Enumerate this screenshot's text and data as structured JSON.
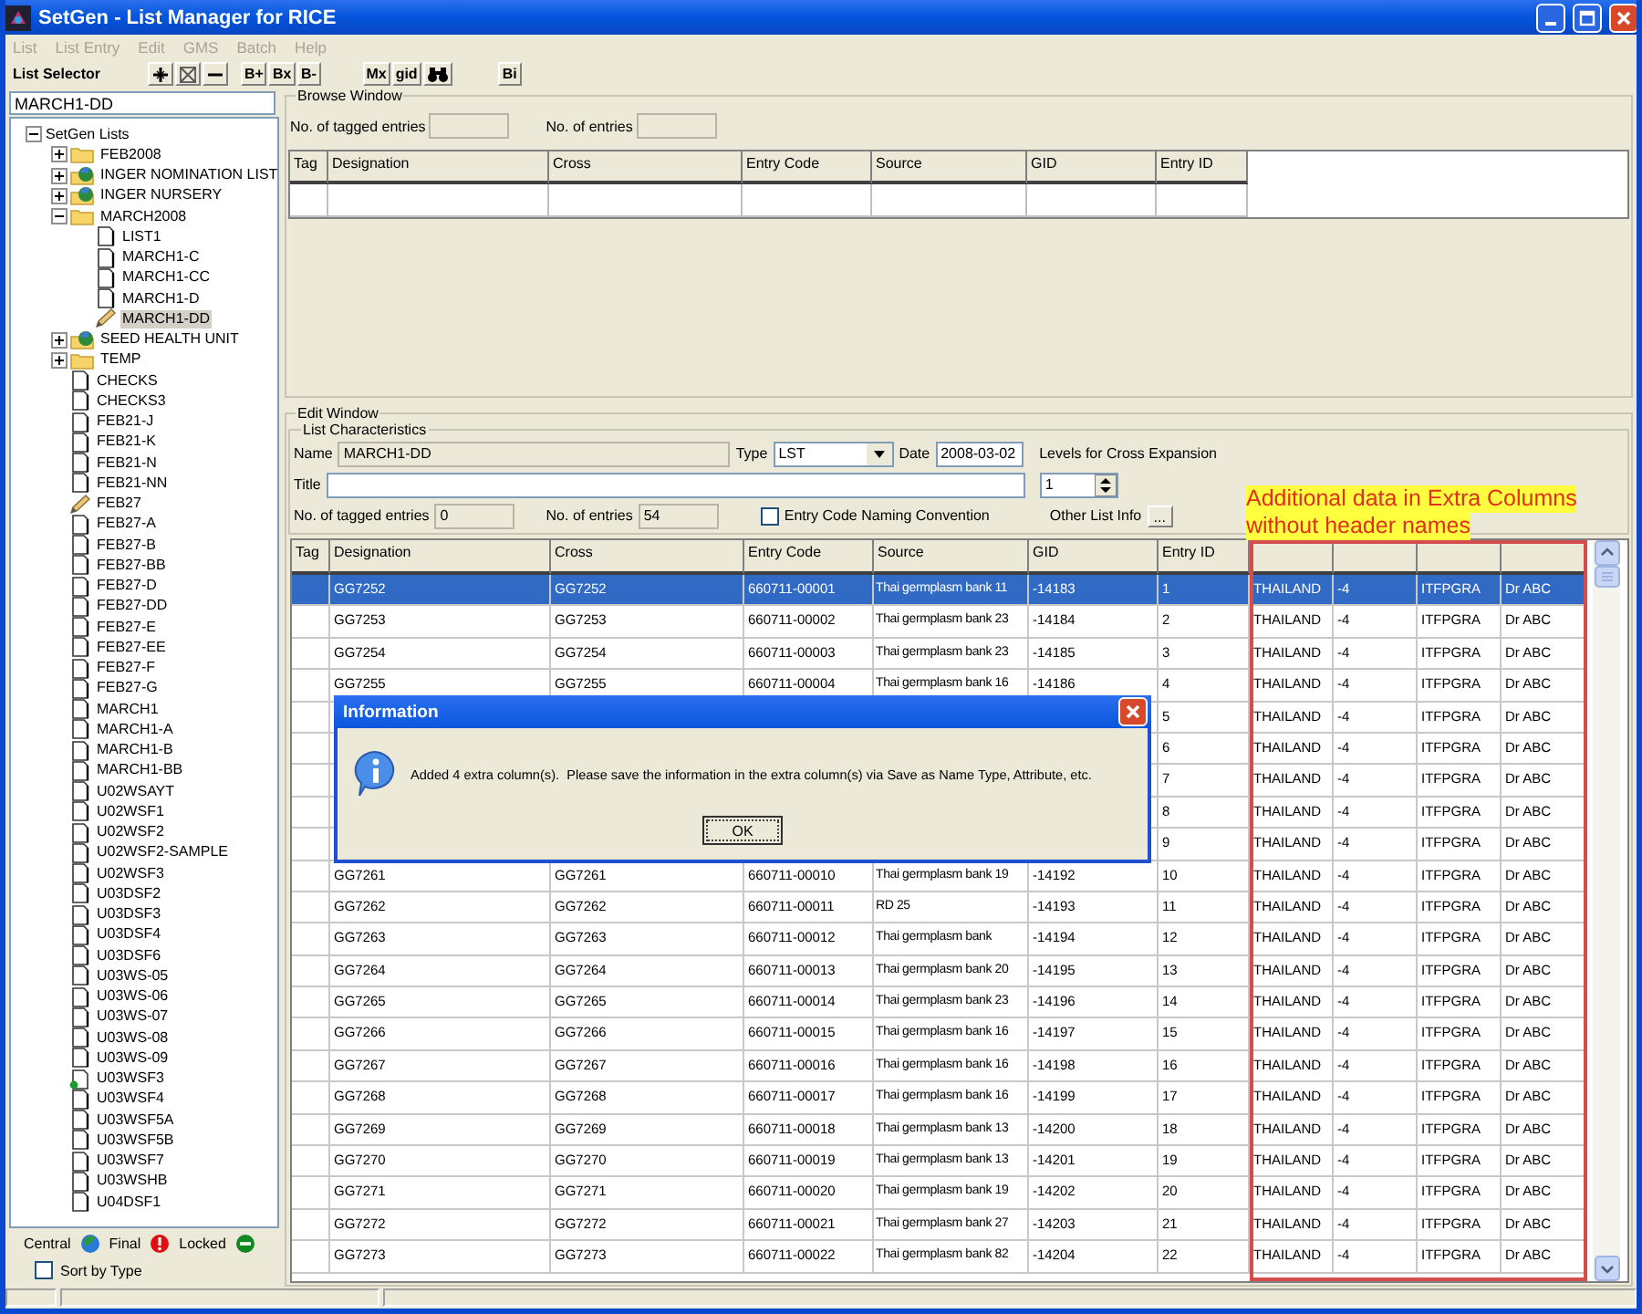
{
  "window": {
    "title": "SetGen - List Manager for RICE"
  },
  "menu": [
    {
      "label": "List",
      "disabled": true
    },
    {
      "label": "List Entry",
      "disabled": true
    },
    {
      "label": "Edit",
      "disabled": true
    },
    {
      "label": "GMS",
      "disabled": true
    },
    {
      "label": "Batch",
      "disabled": true
    },
    {
      "label": "Help",
      "disabled": true
    }
  ],
  "toolbar": {
    "label": "List Selector",
    "button_group_1": [
      "B+",
      "Bx",
      "B-"
    ],
    "button_group_2": [
      "Mx",
      "gid"
    ],
    "button_group_3": [
      "Bi"
    ]
  },
  "list_selector": {
    "value": "MARCH1-DD"
  },
  "tree": {
    "label": "SetGen Lists",
    "expanded": true,
    "selected": false,
    "children": [
      {
        "label": "FEB2008",
        "kind": "folder",
        "expanded": false,
        "selected": false
      },
      {
        "label": "INGER NOMINATION LIST",
        "kind": "central",
        "expanded": false,
        "selected": false
      },
      {
        "label": "INGER NURSERY",
        "kind": "central",
        "expanded": false,
        "selected": false
      },
      {
        "label": "MARCH2008",
        "kind": "folder",
        "expanded": true,
        "selected": false,
        "children": [
          {
            "label": "LIST1",
            "kind": "list",
            "selected": false
          },
          {
            "label": "MARCH1-C",
            "kind": "list",
            "selected": false
          },
          {
            "label": "MARCH1-CC",
            "kind": "list",
            "selected": false
          },
          {
            "label": "MARCH1-D",
            "kind": "list",
            "selected": false
          },
          {
            "label": "MARCH1-DD",
            "kind": "editing",
            "selected": true
          }
        ]
      },
      {
        "label": "SEED HEALTH UNIT",
        "kind": "central",
        "expanded": false,
        "selected": false
      },
      {
        "label": "TEMP",
        "kind": "folder",
        "expanded": false,
        "selected": false
      },
      {
        "label": "CHECKS",
        "kind": "list",
        "selected": false
      },
      {
        "label": "CHECKS3",
        "kind": "list",
        "selected": false
      },
      {
        "label": "FEB21-J",
        "kind": "list",
        "selected": false
      },
      {
        "label": "FEB21-K",
        "kind": "list",
        "selected": false
      },
      {
        "label": "FEB21-N",
        "kind": "list",
        "selected": false
      },
      {
        "label": "FEB21-NN",
        "kind": "list",
        "selected": false
      },
      {
        "label": "FEB27",
        "kind": "editing",
        "selected": false
      },
      {
        "label": "FEB27-A",
        "kind": "list",
        "selected": false
      },
      {
        "label": "FEB27-B",
        "kind": "list",
        "selected": false
      },
      {
        "label": "FEB27-BB",
        "kind": "list",
        "selected": false
      },
      {
        "label": "FEB27-D",
        "kind": "list",
        "selected": false
      },
      {
        "label": "FEB27-DD",
        "kind": "list",
        "selected": false
      },
      {
        "label": "FEB27-E",
        "kind": "list",
        "selected": false
      },
      {
        "label": "FEB27-EE",
        "kind": "list",
        "selected": false
      },
      {
        "label": "FEB27-F",
        "kind": "list",
        "selected": false
      },
      {
        "label": "FEB27-G",
        "kind": "list",
        "selected": false
      },
      {
        "label": "MARCH1",
        "kind": "list",
        "selected": false
      },
      {
        "label": "MARCH1-A",
        "kind": "list",
        "selected": false
      },
      {
        "label": "MARCH1-B",
        "kind": "list",
        "selected": false
      },
      {
        "label": "MARCH1-BB",
        "kind": "list",
        "selected": false
      },
      {
        "label": "U02WSAYT",
        "kind": "list",
        "selected": false
      },
      {
        "label": "U02WSF1",
        "kind": "list",
        "selected": false
      },
      {
        "label": "U02WSF2",
        "kind": "list",
        "selected": false
      },
      {
        "label": "U02WSF2-SAMPLE",
        "kind": "list",
        "selected": false
      },
      {
        "label": "U02WSF3",
        "kind": "list",
        "selected": false
      },
      {
        "label": "U03DSF2",
        "kind": "list",
        "selected": false
      },
      {
        "label": "U03DSF3",
        "kind": "list",
        "selected": false
      },
      {
        "label": "U03DSF4",
        "kind": "list",
        "selected": false
      },
      {
        "label": "U03DSF6",
        "kind": "list",
        "selected": false
      },
      {
        "label": "U03WS-05",
        "kind": "list",
        "selected": false
      },
      {
        "label": "U03WS-06",
        "kind": "list",
        "selected": false
      },
      {
        "label": "U03WS-07",
        "kind": "list",
        "selected": false
      },
      {
        "label": "U03WS-08",
        "kind": "list",
        "selected": false
      },
      {
        "label": "U03WS-09",
        "kind": "list",
        "selected": false
      },
      {
        "label": "U03WSF3",
        "kind": "locked",
        "selected": false
      },
      {
        "label": "U03WSF4",
        "kind": "list",
        "selected": false
      },
      {
        "label": "U03WSF5A",
        "kind": "list",
        "selected": false
      },
      {
        "label": "U03WSF5B",
        "kind": "list",
        "selected": false
      },
      {
        "label": "U03WSF7",
        "kind": "list",
        "selected": false
      },
      {
        "label": "U03WSHB",
        "kind": "list",
        "selected": false
      },
      {
        "label": "U04DSF1",
        "kind": "list",
        "selected": false
      }
    ]
  },
  "legend": [
    {
      "label": "Central",
      "kind": "central"
    },
    {
      "label": "Final",
      "kind": "final"
    },
    {
      "label": "Locked",
      "kind": "locked"
    }
  ],
  "sort_by_type": {
    "label": "Sort by Type",
    "checked": false
  },
  "browse_window": {
    "title": "Browse Window",
    "tagged_label": "No. of tagged entries",
    "entries_label": "No. of entries",
    "columns": [
      "Tag",
      "Designation",
      "Cross",
      "Entry Code",
      "Source",
      "GID",
      "Entry ID"
    ]
  },
  "edit_window": {
    "title": "Edit Window",
    "characteristics": {
      "title": "List Characteristics",
      "name_label": "Name",
      "name": "MARCH1-DD",
      "type_label": "Type",
      "type": "LST",
      "date_label": "Date",
      "date": "2008-03-02",
      "levels_label": "Levels for Cross Expansion",
      "levels": "1",
      "title_label": "Title",
      "tagged_label": "No. of tagged entries",
      "tagged": "0",
      "entries_label": "No. of entries",
      "entries": "54",
      "naming_convention": {
        "label": "Entry Code Naming Convention",
        "checked": false
      },
      "other_info_label": "Other List Info",
      "other_info_button": "..."
    },
    "columns": [
      "Tag",
      "Designation",
      "Cross",
      "Entry Code",
      "Source",
      "GID",
      "Entry ID"
    ],
    "rows": [
      {
        "selected": true,
        "cells": [
          null,
          "GG7252",
          "GG7252",
          "660711-00001",
          "Thai germplasm bank 11",
          "-14183",
          "1",
          "THAILAND",
          "-4",
          "ITFPGRA",
          "Dr ABC"
        ]
      },
      {
        "selected": false,
        "cells": [
          null,
          "GG7253",
          "GG7253",
          "660711-00002",
          "Thai germplasm bank 23",
          "-14184",
          "2",
          "THAILAND",
          "-4",
          "ITFPGRA",
          "Dr ABC"
        ]
      },
      {
        "selected": false,
        "cells": [
          null,
          "GG7254",
          "GG7254",
          "660711-00003",
          "Thai germplasm bank 23",
          "-14185",
          "3",
          "THAILAND",
          "-4",
          "ITFPGRA",
          "Dr ABC"
        ]
      },
      {
        "selected": false,
        "cells": [
          null,
          "GG7255",
          "GG7255",
          "660711-00004",
          "Thai germplasm bank 16",
          "-14186",
          "4",
          "THAILAND",
          "-4",
          "ITFPGRA",
          "Dr ABC"
        ]
      },
      {
        "selected": false,
        "cells": [
          null,
          null,
          null,
          null,
          null,
          null,
          "5",
          "THAILAND",
          "-4",
          "ITFPGRA",
          "Dr ABC"
        ]
      },
      {
        "selected": false,
        "cells": [
          null,
          null,
          null,
          null,
          null,
          null,
          "6",
          "THAILAND",
          "-4",
          "ITFPGRA",
          "Dr ABC"
        ]
      },
      {
        "selected": false,
        "cells": [
          null,
          null,
          null,
          null,
          null,
          null,
          "7",
          "THAILAND",
          "-4",
          "ITFPGRA",
          "Dr ABC"
        ]
      },
      {
        "selected": false,
        "cells": [
          null,
          null,
          null,
          null,
          null,
          null,
          "8",
          "THAILAND",
          "-4",
          "ITFPGRA",
          "Dr ABC"
        ]
      },
      {
        "selected": false,
        "cells": [
          null,
          null,
          null,
          null,
          null,
          null,
          "9",
          "THAILAND",
          "-4",
          "ITFPGRA",
          "Dr ABC"
        ]
      },
      {
        "selected": false,
        "cells": [
          null,
          "GG7261",
          "GG7261",
          "660711-00010",
          "Thai germplasm bank 19",
          "-14192",
          "10",
          "THAILAND",
          "-4",
          "ITFPGRA",
          "Dr ABC"
        ]
      },
      {
        "selected": false,
        "cells": [
          null,
          "GG7262",
          "GG7262",
          "660711-00011",
          "RD 25",
          "-14193",
          "11",
          "THAILAND",
          "-4",
          "ITFPGRA",
          "Dr ABC"
        ]
      },
      {
        "selected": false,
        "cells": [
          null,
          "GG7263",
          "GG7263",
          "660711-00012",
          "Thai germplasm bank",
          "-14194",
          "12",
          "THAILAND",
          "-4",
          "ITFPGRA",
          "Dr ABC"
        ]
      },
      {
        "selected": false,
        "cells": [
          null,
          "GG7264",
          "GG7264",
          "660711-00013",
          "Thai germplasm bank 20",
          "-14195",
          "13",
          "THAILAND",
          "-4",
          "ITFPGRA",
          "Dr ABC"
        ]
      },
      {
        "selected": false,
        "cells": [
          null,
          "GG7265",
          "GG7265",
          "660711-00014",
          "Thai germplasm bank 23",
          "-14196",
          "14",
          "THAILAND",
          "-4",
          "ITFPGRA",
          "Dr ABC"
        ]
      },
      {
        "selected": false,
        "cells": [
          null,
          "GG7266",
          "GG7266",
          "660711-00015",
          "Thai germplasm bank 16",
          "-14197",
          "15",
          "THAILAND",
          "-4",
          "ITFPGRA",
          "Dr ABC"
        ]
      },
      {
        "selected": false,
        "cells": [
          null,
          "GG7267",
          "GG7267",
          "660711-00016",
          "Thai germplasm bank 16",
          "-14198",
          "16",
          "THAILAND",
          "-4",
          "ITFPGRA",
          "Dr ABC"
        ]
      },
      {
        "selected": false,
        "cells": [
          null,
          "GG7268",
          "GG7268",
          "660711-00017",
          "Thai germplasm bank 16",
          "-14199",
          "17",
          "THAILAND",
          "-4",
          "ITFPGRA",
          "Dr ABC"
        ]
      },
      {
        "selected": false,
        "cells": [
          null,
          "GG7269",
          "GG7269",
          "660711-00018",
          "Thai germplasm bank 13",
          "-14200",
          "18",
          "THAILAND",
          "-4",
          "ITFPGRA",
          "Dr ABC"
        ]
      },
      {
        "selected": false,
        "cells": [
          null,
          "GG7270",
          "GG7270",
          "660711-00019",
          "Thai germplasm bank 13",
          "-14201",
          "19",
          "THAILAND",
          "-4",
          "ITFPGRA",
          "Dr ABC"
        ]
      },
      {
        "selected": false,
        "cells": [
          null,
          "GG7271",
          "GG7271",
          "660711-00020",
          "Thai germplasm bank 19",
          "-14202",
          "20",
          "THAILAND",
          "-4",
          "ITFPGRA",
          "Dr ABC"
        ]
      },
      {
        "selected": false,
        "cells": [
          null,
          "GG7272",
          "GG7272",
          "660711-00021",
          "Thai germplasm bank 27",
          "-14203",
          "21",
          "THAILAND",
          "-4",
          "ITFPGRA",
          "Dr ABC"
        ]
      },
      {
        "selected": false,
        "cells": [
          null,
          "GG7273",
          "GG7273",
          "660711-00022",
          "Thai germplasm bank 82",
          "-14204",
          "22",
          "THAILAND",
          "-4",
          "ITFPGRA",
          "Dr ABC"
        ]
      }
    ]
  },
  "annotation": {
    "lines": [
      "Additional data in Extra Columns",
      "without header names"
    ]
  },
  "dialog": {
    "title": "Information",
    "message": "Added 4 extra column(s).  Please save the information in the extra column(s) via Save as Name Type, Attribute, etc.",
    "button": "OK"
  }
}
